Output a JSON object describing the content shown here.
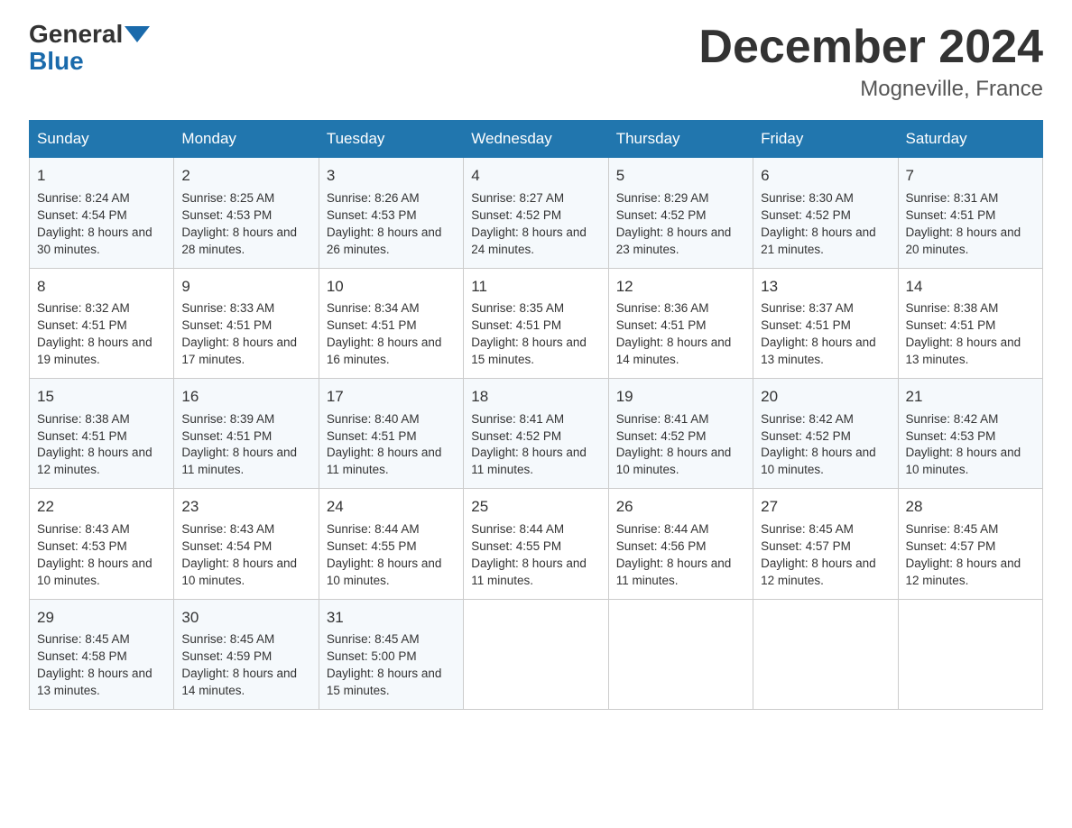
{
  "header": {
    "logo_general": "General",
    "logo_blue": "Blue",
    "month_year": "December 2024",
    "location": "Mogneville, France"
  },
  "weekdays": [
    "Sunday",
    "Monday",
    "Tuesday",
    "Wednesday",
    "Thursday",
    "Friday",
    "Saturday"
  ],
  "weeks": [
    [
      {
        "day": "1",
        "sunrise": "Sunrise: 8:24 AM",
        "sunset": "Sunset: 4:54 PM",
        "daylight": "Daylight: 8 hours and 30 minutes."
      },
      {
        "day": "2",
        "sunrise": "Sunrise: 8:25 AM",
        "sunset": "Sunset: 4:53 PM",
        "daylight": "Daylight: 8 hours and 28 minutes."
      },
      {
        "day": "3",
        "sunrise": "Sunrise: 8:26 AM",
        "sunset": "Sunset: 4:53 PM",
        "daylight": "Daylight: 8 hours and 26 minutes."
      },
      {
        "day": "4",
        "sunrise": "Sunrise: 8:27 AM",
        "sunset": "Sunset: 4:52 PM",
        "daylight": "Daylight: 8 hours and 24 minutes."
      },
      {
        "day": "5",
        "sunrise": "Sunrise: 8:29 AM",
        "sunset": "Sunset: 4:52 PM",
        "daylight": "Daylight: 8 hours and 23 minutes."
      },
      {
        "day": "6",
        "sunrise": "Sunrise: 8:30 AM",
        "sunset": "Sunset: 4:52 PM",
        "daylight": "Daylight: 8 hours and 21 minutes."
      },
      {
        "day": "7",
        "sunrise": "Sunrise: 8:31 AM",
        "sunset": "Sunset: 4:51 PM",
        "daylight": "Daylight: 8 hours and 20 minutes."
      }
    ],
    [
      {
        "day": "8",
        "sunrise": "Sunrise: 8:32 AM",
        "sunset": "Sunset: 4:51 PM",
        "daylight": "Daylight: 8 hours and 19 minutes."
      },
      {
        "day": "9",
        "sunrise": "Sunrise: 8:33 AM",
        "sunset": "Sunset: 4:51 PM",
        "daylight": "Daylight: 8 hours and 17 minutes."
      },
      {
        "day": "10",
        "sunrise": "Sunrise: 8:34 AM",
        "sunset": "Sunset: 4:51 PM",
        "daylight": "Daylight: 8 hours and 16 minutes."
      },
      {
        "day": "11",
        "sunrise": "Sunrise: 8:35 AM",
        "sunset": "Sunset: 4:51 PM",
        "daylight": "Daylight: 8 hours and 15 minutes."
      },
      {
        "day": "12",
        "sunrise": "Sunrise: 8:36 AM",
        "sunset": "Sunset: 4:51 PM",
        "daylight": "Daylight: 8 hours and 14 minutes."
      },
      {
        "day": "13",
        "sunrise": "Sunrise: 8:37 AM",
        "sunset": "Sunset: 4:51 PM",
        "daylight": "Daylight: 8 hours and 13 minutes."
      },
      {
        "day": "14",
        "sunrise": "Sunrise: 8:38 AM",
        "sunset": "Sunset: 4:51 PM",
        "daylight": "Daylight: 8 hours and 13 minutes."
      }
    ],
    [
      {
        "day": "15",
        "sunrise": "Sunrise: 8:38 AM",
        "sunset": "Sunset: 4:51 PM",
        "daylight": "Daylight: 8 hours and 12 minutes."
      },
      {
        "day": "16",
        "sunrise": "Sunrise: 8:39 AM",
        "sunset": "Sunset: 4:51 PM",
        "daylight": "Daylight: 8 hours and 11 minutes."
      },
      {
        "day": "17",
        "sunrise": "Sunrise: 8:40 AM",
        "sunset": "Sunset: 4:51 PM",
        "daylight": "Daylight: 8 hours and 11 minutes."
      },
      {
        "day": "18",
        "sunrise": "Sunrise: 8:41 AM",
        "sunset": "Sunset: 4:52 PM",
        "daylight": "Daylight: 8 hours and 11 minutes."
      },
      {
        "day": "19",
        "sunrise": "Sunrise: 8:41 AM",
        "sunset": "Sunset: 4:52 PM",
        "daylight": "Daylight: 8 hours and 10 minutes."
      },
      {
        "day": "20",
        "sunrise": "Sunrise: 8:42 AM",
        "sunset": "Sunset: 4:52 PM",
        "daylight": "Daylight: 8 hours and 10 minutes."
      },
      {
        "day": "21",
        "sunrise": "Sunrise: 8:42 AM",
        "sunset": "Sunset: 4:53 PM",
        "daylight": "Daylight: 8 hours and 10 minutes."
      }
    ],
    [
      {
        "day": "22",
        "sunrise": "Sunrise: 8:43 AM",
        "sunset": "Sunset: 4:53 PM",
        "daylight": "Daylight: 8 hours and 10 minutes."
      },
      {
        "day": "23",
        "sunrise": "Sunrise: 8:43 AM",
        "sunset": "Sunset: 4:54 PM",
        "daylight": "Daylight: 8 hours and 10 minutes."
      },
      {
        "day": "24",
        "sunrise": "Sunrise: 8:44 AM",
        "sunset": "Sunset: 4:55 PM",
        "daylight": "Daylight: 8 hours and 10 minutes."
      },
      {
        "day": "25",
        "sunrise": "Sunrise: 8:44 AM",
        "sunset": "Sunset: 4:55 PM",
        "daylight": "Daylight: 8 hours and 11 minutes."
      },
      {
        "day": "26",
        "sunrise": "Sunrise: 8:44 AM",
        "sunset": "Sunset: 4:56 PM",
        "daylight": "Daylight: 8 hours and 11 minutes."
      },
      {
        "day": "27",
        "sunrise": "Sunrise: 8:45 AM",
        "sunset": "Sunset: 4:57 PM",
        "daylight": "Daylight: 8 hours and 12 minutes."
      },
      {
        "day": "28",
        "sunrise": "Sunrise: 8:45 AM",
        "sunset": "Sunset: 4:57 PM",
        "daylight": "Daylight: 8 hours and 12 minutes."
      }
    ],
    [
      {
        "day": "29",
        "sunrise": "Sunrise: 8:45 AM",
        "sunset": "Sunset: 4:58 PM",
        "daylight": "Daylight: 8 hours and 13 minutes."
      },
      {
        "day": "30",
        "sunrise": "Sunrise: 8:45 AM",
        "sunset": "Sunset: 4:59 PM",
        "daylight": "Daylight: 8 hours and 14 minutes."
      },
      {
        "day": "31",
        "sunrise": "Sunrise: 8:45 AM",
        "sunset": "Sunset: 5:00 PM",
        "daylight": "Daylight: 8 hours and 15 minutes."
      },
      null,
      null,
      null,
      null
    ]
  ]
}
